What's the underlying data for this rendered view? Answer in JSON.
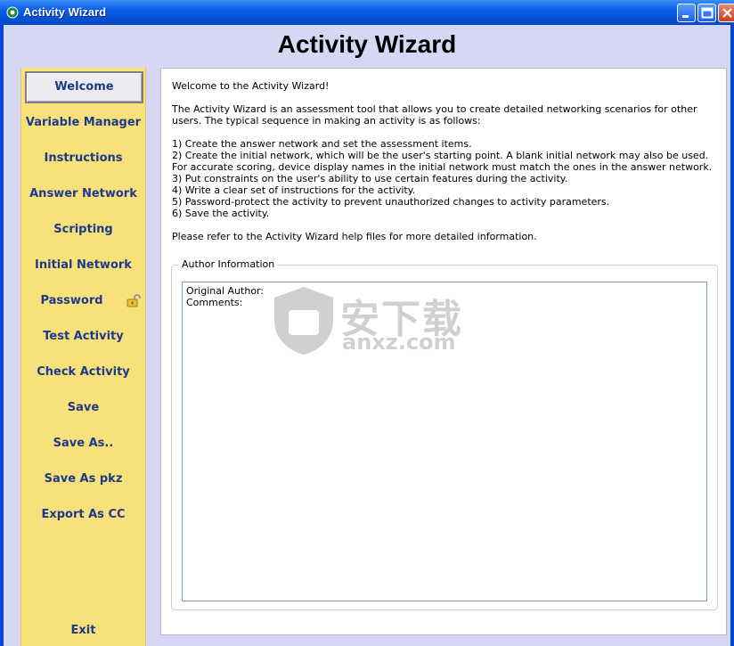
{
  "window": {
    "title": "Activity Wizard",
    "colors": {
      "titlebar": "#0552d6",
      "sidebar": "#f8e07a",
      "nav_text": "#1c3a8a",
      "background": "#d6d6f5"
    }
  },
  "header": {
    "title": "Activity Wizard"
  },
  "sidebar": {
    "items": [
      {
        "label": "Welcome",
        "active": true
      },
      {
        "label": "Variable Manager"
      },
      {
        "label": "Instructions"
      },
      {
        "label": "Answer Network"
      },
      {
        "label": "Scripting"
      },
      {
        "label": "Initial Network"
      },
      {
        "label": "Password",
        "icon": "lock-icon"
      },
      {
        "label": "Test Activity"
      },
      {
        "label": "Check Activity"
      },
      {
        "label": "Save"
      },
      {
        "label": "Save As.."
      },
      {
        "label": "Save As pkz"
      },
      {
        "label": "Export As CC"
      }
    ],
    "exit_label": "Exit"
  },
  "content": {
    "welcome": "Welcome to the Activity Wizard!",
    "intro": "The Activity Wizard is an assessment tool that allows you to create detailed networking scenarios for other users. The typical sequence in making an activity is as follows:",
    "steps": [
      "1) Create the answer network and set the assessment items.",
      "2) Create the initial network, which will be the user's starting point. A blank initial network may also be used. For accurate scoring, device display names in the initial network must match the ones in the answer network.",
      "3) Put constraints on the user's ability to use certain features during the activity.",
      "4) Write a clear set of instructions for the activity.",
      "5) Password-protect the activity to prevent unauthorized changes to activity parameters.",
      "6) Save the activity."
    ],
    "refer": "Please refer to the Activity Wizard help files for more detailed information.",
    "author_group": {
      "legend": "Author Information",
      "text": "Original Author:\nComments:"
    }
  },
  "watermark": {
    "cn": "安下载",
    "en": "anxz.com"
  }
}
